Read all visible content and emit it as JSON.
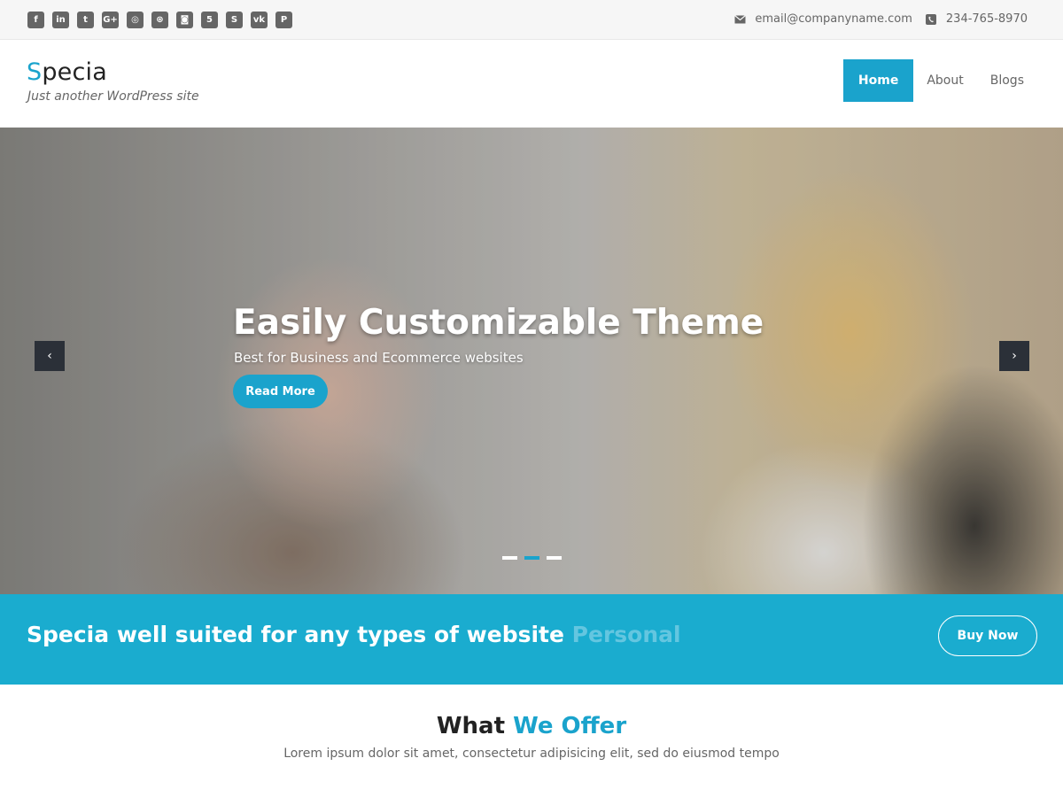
{
  "topbar": {
    "social": [
      {
        "icon": "facebook-icon",
        "glyph": "f"
      },
      {
        "icon": "linkedin-icon",
        "glyph": "in"
      },
      {
        "icon": "twitter-icon",
        "glyph": "t"
      },
      {
        "icon": "google-plus-icon",
        "glyph": "G+"
      },
      {
        "icon": "instagram-icon",
        "glyph": "◎"
      },
      {
        "icon": "dribbble-icon",
        "glyph": "⊛"
      },
      {
        "icon": "github-icon",
        "glyph": "◙"
      },
      {
        "icon": "html5-icon",
        "glyph": "5"
      },
      {
        "icon": "skype-icon",
        "glyph": "S"
      },
      {
        "icon": "vk-icon",
        "glyph": "vk"
      },
      {
        "icon": "pinterest-icon",
        "glyph": "P"
      }
    ],
    "email": "email@companyname.com",
    "phone": "234-765-8970"
  },
  "header": {
    "logo_first": "S",
    "logo_rest": "pecia",
    "tagline": "Just another WordPress site",
    "nav": [
      "Home",
      "About",
      "Blogs"
    ],
    "active_nav": "Home"
  },
  "hero": {
    "title": "Easily Customizable Theme",
    "subtitle": "Best for Business and Ecommerce websites",
    "button": "Read More",
    "prev_glyph": "‹",
    "next_glyph": "›",
    "slide_count": 3,
    "active_slide": 2
  },
  "callout": {
    "text": "Specia well suited for any types of website ",
    "highlight": "Personal",
    "button": "Buy Now"
  },
  "offer": {
    "title_plain": "What ",
    "title_accent": "We Offer",
    "subtitle": "Lorem ipsum dolor sit amet, consectetur adipisicing elit, sed do eiusmod tempo"
  },
  "colors": {
    "accent": "#1aa3cc",
    "callout_bg": "#1aaccf",
    "topbar_bg": "#f6f6f6",
    "arrow_bg": "#2b3038"
  }
}
